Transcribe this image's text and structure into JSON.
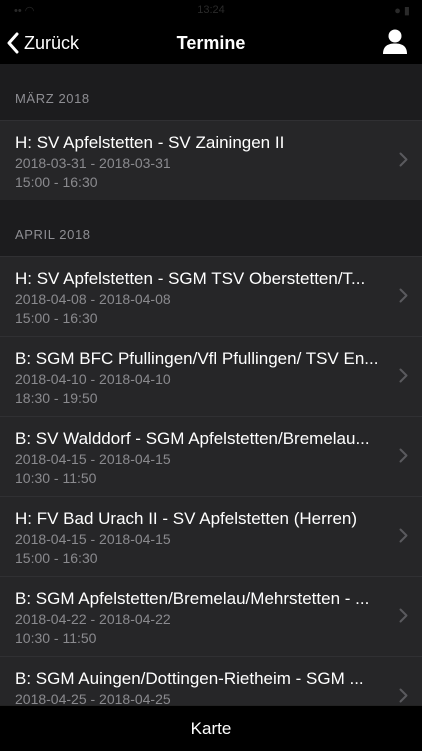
{
  "status_bar": {
    "time": "13:24",
    "left": "•• ◠",
    "right": "● ▮"
  },
  "nav": {
    "back_label": "Zurück",
    "title": "Termine"
  },
  "sections": [
    {
      "header": "MÄRZ 2018",
      "items": [
        {
          "title": "H: SV Apfelstetten - SV Zainingen II",
          "date": "2018-03-31 - 2018-03-31",
          "time": "15:00 - 16:30"
        }
      ]
    },
    {
      "header": "APRIL 2018",
      "items": [
        {
          "title": "H: SV Apfelstetten - SGM TSV Oberstetten/T...",
          "date": "2018-04-08 - 2018-04-08",
          "time": "15:00 - 16:30"
        },
        {
          "title": "B: SGM BFC Pfullingen/Vfl Pfullingen/ TSV En...",
          "date": "2018-04-10 - 2018-04-10",
          "time": "18:30 - 19:50"
        },
        {
          "title": "B: SV Walddorf - SGM Apfelstetten/Bremelau...",
          "date": "2018-04-15 - 2018-04-15",
          "time": "10:30 - 11:50"
        },
        {
          "title": "H: FV Bad Urach II - SV Apfelstetten (Herren)",
          "date": "2018-04-15 - 2018-04-15",
          "time": "15:00 - 16:30"
        },
        {
          "title": "B: SGM Apfelstetten/Bremelau/Mehrstetten - ...",
          "date": "2018-04-22 - 2018-04-22",
          "time": "10:30 - 11:50"
        },
        {
          "title": "B: SGM Auingen/Dottingen-Rietheim - SGM ...",
          "date": "2018-04-25 - 2018-04-25",
          "time": ""
        }
      ]
    }
  ],
  "tabbar": {
    "karte_label": "Karte"
  },
  "colors": {
    "background": "#1c1c1e",
    "cell": "#262628",
    "bar": "#000000",
    "secondary_text": "#8a8a8e"
  }
}
